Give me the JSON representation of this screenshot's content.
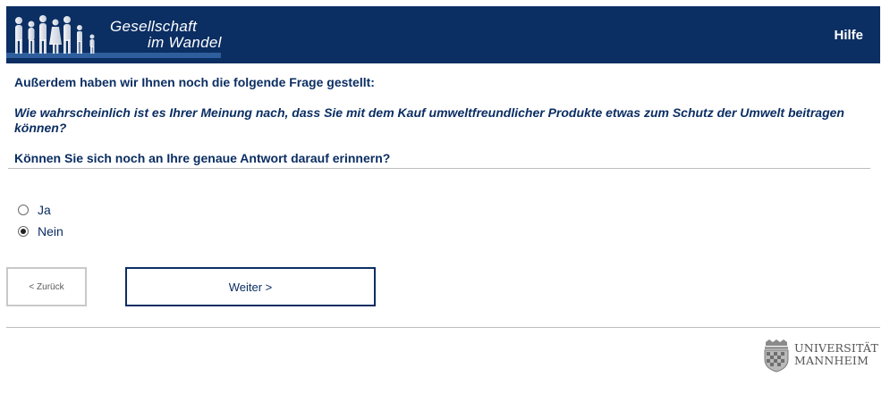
{
  "header": {
    "brand_line1": "Gesellschaft",
    "brand_line2": "im Wandel",
    "help_label": "Hilfe",
    "background": "#0b2e63"
  },
  "content": {
    "intro": "Außerdem haben wir Ihnen noch die folgende Frage gestellt:",
    "question": "Wie wahrscheinlich ist es Ihrer Meinung nach, dass Sie mit dem Kauf umweltfreundlicher Produkte etwas zum Schutz der Umwelt beitragen können?",
    "prompt": "Können Sie sich noch an Ihre genaue Antwort darauf erinnern?"
  },
  "options": [
    {
      "label": "Ja",
      "selected": false
    },
    {
      "label": "Nein",
      "selected": true
    }
  ],
  "nav": {
    "back_label": "< Zurück",
    "next_label": "Weiter >"
  },
  "footer": {
    "uni_line1": "UNIVERSITÄT",
    "uni_line2": "MANNHEIM",
    "crest_icon": "university-crest-icon"
  }
}
